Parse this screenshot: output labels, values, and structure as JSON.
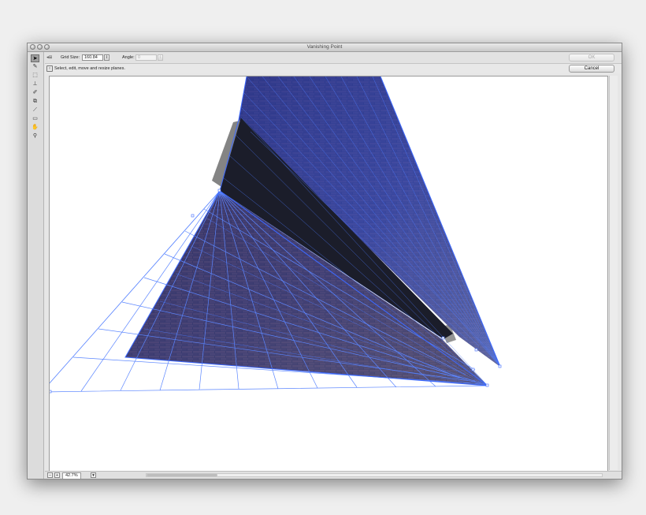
{
  "window": {
    "title": "Vanishing Point"
  },
  "options": {
    "grid_size_label": "Grid Size:",
    "grid_size_value": "160.84",
    "angle_label": "Angle:",
    "angle_value": "0"
  },
  "info": {
    "tip": "Select, edit, move and resize planes."
  },
  "buttons": {
    "ok": "OK",
    "cancel": "Cancel"
  },
  "status": {
    "zoom": "42.7%"
  },
  "icons": {
    "edit_plane": "arrow-cursor-icon",
    "create_plane": "create-plane-icon",
    "marquee": "marquee-icon",
    "stamp": "stamp-icon",
    "brush": "brush-icon",
    "transform": "transform-icon",
    "eyedropper": "eyedropper-icon",
    "measure": "measure-icon",
    "hand": "hand-icon",
    "zoom": "zoom-icon"
  },
  "colors": {
    "grid_line": "#4a7bff",
    "brick": "#3a2a24",
    "accent_blue": "#2a5cff"
  }
}
